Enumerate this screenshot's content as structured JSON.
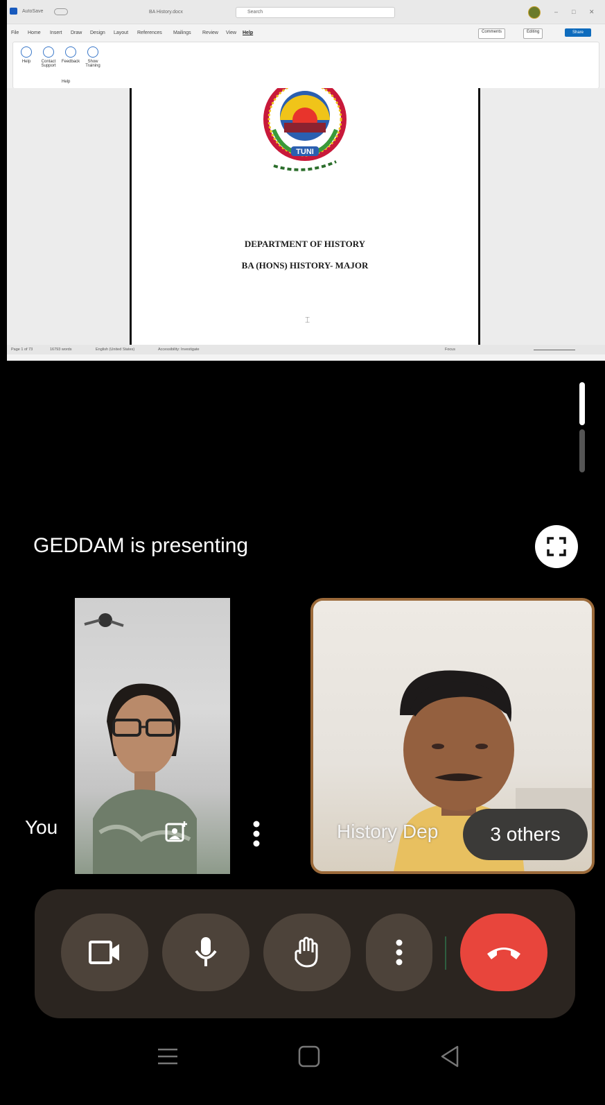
{
  "word": {
    "autosave_label": "AutoSave",
    "doc_title": "BA History.docx",
    "search_placeholder": "Search",
    "tabs": [
      "File",
      "Home",
      "Insert",
      "Draw",
      "Design",
      "Layout",
      "References",
      "Mailings",
      "Review",
      "View",
      "Help"
    ],
    "active_tab": "Help",
    "comments_label": "Comments",
    "editing_label": "Editing",
    "share_label": "Share",
    "ribbon_buttons": [
      "Help",
      "Contact Support",
      "Feedback",
      "Show Training"
    ],
    "ribbon_group": "Help",
    "doc_lines": [
      "DEPARTMENT OF HISTORY",
      "BA (HONS) HISTORY- MAJOR"
    ],
    "logo_text": "TUNI",
    "status": {
      "page": "Page 1 of 73",
      "words": "16793 words",
      "text_predictions": "English (United States)",
      "accessibility": "Accessibility: Investigate",
      "focus": "Focus"
    }
  },
  "meet": {
    "presenting_text": "GEDDAM is presenting",
    "self_label": "You",
    "other_label": "History Dep",
    "others_badge": "3 others"
  },
  "controls": {
    "camera_icon": "video-camera-icon",
    "mic_icon": "microphone-icon",
    "hand_icon": "raise-hand-icon",
    "more_icon": "more-vert-icon",
    "end_icon": "end-call-icon"
  },
  "colors": {
    "end_call": "#e8453c",
    "control_button": "#4d433a",
    "control_bar": "#2b2520",
    "active_speaker_border": "#9b6a3a"
  }
}
